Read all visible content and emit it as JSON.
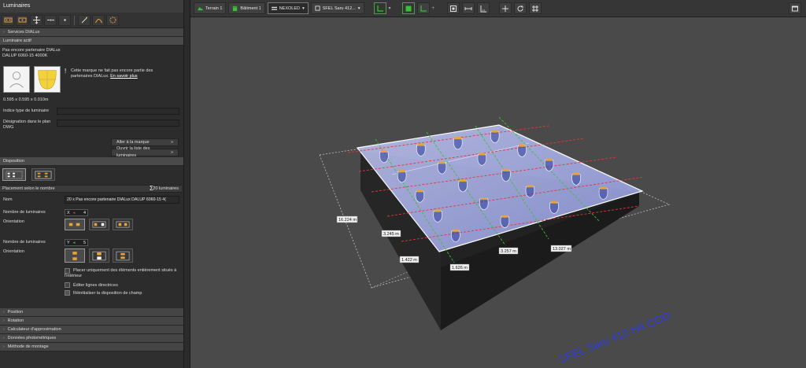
{
  "panel": {
    "title": "Luminaires",
    "services_header": "Services DIALux",
    "active_header": "Luminaire actif",
    "lum_name_line1": "Pas encore partenaire DIALux",
    "lum_name_line2": "DALUP 6060-15 4000K",
    "notice_excl": "!",
    "notice_text": "Cette marque ne fait pas encore partie des partenaires DIALux.",
    "notice_link": "En savoir plus",
    "dimensions": "0.595 x 0.595 x 0.010m",
    "indice_label": "Indice type de luminaire",
    "designation_label": "Désignation dans le plan DWG",
    "btn_brand": "Aller à la marque",
    "btn_list": "Ouvrir la liste des luminaires",
    "disposition_header": "Disposition",
    "placement_label": "Placement selon le nombre",
    "total_label": "20 luminaires",
    "nom_label": "Nom",
    "nom_value": "20 x Pas encore partenaire DIALux DALUP 6060-15 4(",
    "count_label_x": "Nombre de luminaires",
    "axis_x": "X",
    "count_x": "4",
    "orientation_label": "Orientation",
    "count_label_y": "Nombre de luminaires",
    "axis_y": "Y",
    "count_y": "5",
    "orientation_label_2": "Orientation",
    "check1": "Placer uniquement des éléments entièrement situés à l'intérieur",
    "check2": "Éditer lignes directrices",
    "check3": "Réinitialiser la disposition de champ",
    "collapsed": [
      "Position",
      "Rotation",
      "Calculateur d'approximation",
      "Données photométriques",
      "Méthode de montage"
    ]
  },
  "tabs": {
    "terrain": "Terrain 1",
    "batiment": "Bâtiment 1",
    "level": "NEXOLED",
    "room": "SFEL Saru 412..."
  },
  "viewport": {
    "dim_left": "16.224 m",
    "dim_a": "3.245 m",
    "dim_b": "1.422 m",
    "dim_c": "1.626 m",
    "dim_d": "3.257 m",
    "dim_e": "13.027 m",
    "floor_text": "SFEL Saru 412 H4 COD"
  },
  "colors": {
    "accent_green": "#3bbf3b",
    "grid_red": "#e03a3a",
    "selection_white": "#ffffff",
    "floor_text": "#2e3ae0"
  }
}
